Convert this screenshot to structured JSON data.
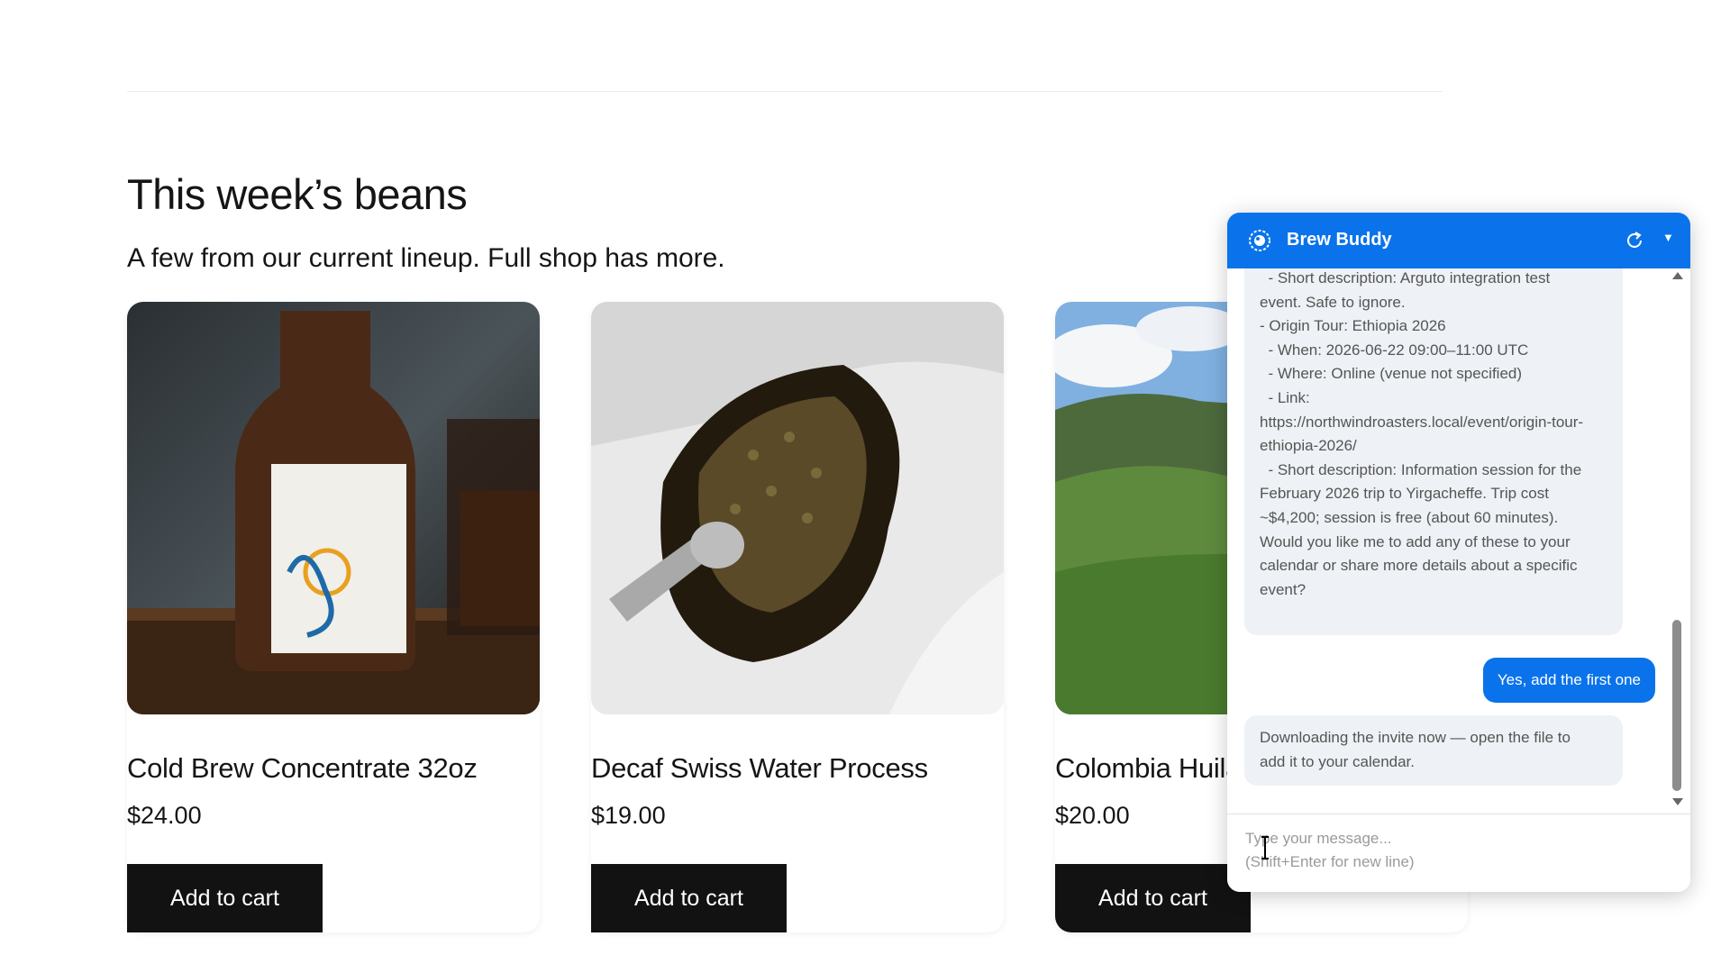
{
  "section": {
    "title": "This week’s beans",
    "subtitle": "A few from our current lineup. Full shop has more."
  },
  "products": [
    {
      "name": "Cold Brew Concentrate 32oz",
      "price": "$24.00",
      "button": "Add to cart"
    },
    {
      "name": "Decaf Swiss Water Process",
      "price": "$19.00",
      "button": "Add to cart"
    },
    {
      "name": "Colombia Huila",
      "price": "$20.00",
      "button": "Add to cart"
    }
  ],
  "chat": {
    "title": "Brew Buddy",
    "header_icons": [
      "brew-buddy-logo-icon",
      "refresh-icon",
      "caret-down-icon"
    ],
    "accent_color": "#0a73eb",
    "bot_message_1_lines": [
      "  - Short description: Arguto integration test",
      "event. Safe to ignore.",
      "",
      "- Origin Tour: Ethiopia 2026",
      "  - When: 2026-06-22 09:00–11:00 UTC",
      "  - Where: Online (venue not specified)",
      "  - Link:",
      "https://northwindroasters.local/event/origin-tour-",
      "ethiopia-2026/",
      "  - Short description: Information session for the",
      "February 2026 trip to Yirgacheffe. Trip cost",
      "~$4,200; session is free (about 60 minutes).",
      "",
      "Would you like me to add any of these to your",
      "calendar or share more details about a specific",
      "event?"
    ],
    "user_message": "Yes, add the first one",
    "bot_message_2_lines": [
      "Downloading the invite now — open the file to",
      "add it to your calendar."
    ],
    "input_placeholder": "Type your message...\n(Shift+Enter for new line)"
  }
}
